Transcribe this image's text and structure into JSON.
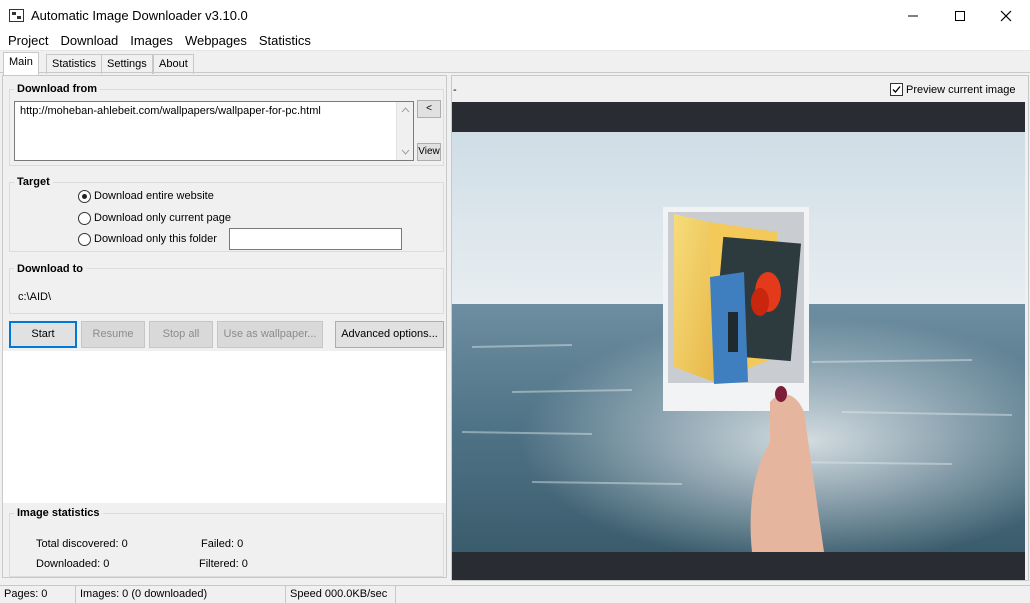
{
  "window": {
    "title": "Automatic Image Downloader  v3.10.0"
  },
  "menu": {
    "items": [
      "Project",
      "Download",
      "Images",
      "Webpages",
      "Statistics"
    ]
  },
  "tabs": [
    "Main",
    "Statistics",
    "Settings",
    "About"
  ],
  "download_from": {
    "label": "Download from",
    "url": "http://moheban-ahlebeit.com/wallpapers/wallpaper-for-pc.html",
    "back_button": "<",
    "view_button": "View"
  },
  "target": {
    "label": "Target",
    "options": [
      "Download entire website",
      "Download only current page",
      "Download only this folder"
    ],
    "selected": "Download entire website",
    "folder_value": ""
  },
  "download_to": {
    "label": "Download to",
    "path": "c:\\AID\\"
  },
  "buttons": {
    "start": "Start",
    "resume": "Resume",
    "stop_all": "Stop all",
    "use_as_wallpaper": "Use as wallpaper...",
    "advanced": "Advanced options..."
  },
  "image_statistics": {
    "label": "Image statistics",
    "total_discovered": "Total discovered: 0",
    "failed": "Failed: 0",
    "downloaded": "Downloaded: 0",
    "filtered": "Filtered: 0"
  },
  "preview": {
    "dash": "-",
    "checkbox_label": "Preview current image",
    "checked": true
  },
  "status": {
    "pages": "Pages: 0",
    "images": "Images: 0 (0 downloaded)",
    "speed": "Speed 000.0KB/sec"
  },
  "colors": {
    "accent": "#0078d7",
    "preview_bg": "#2a2c34"
  }
}
